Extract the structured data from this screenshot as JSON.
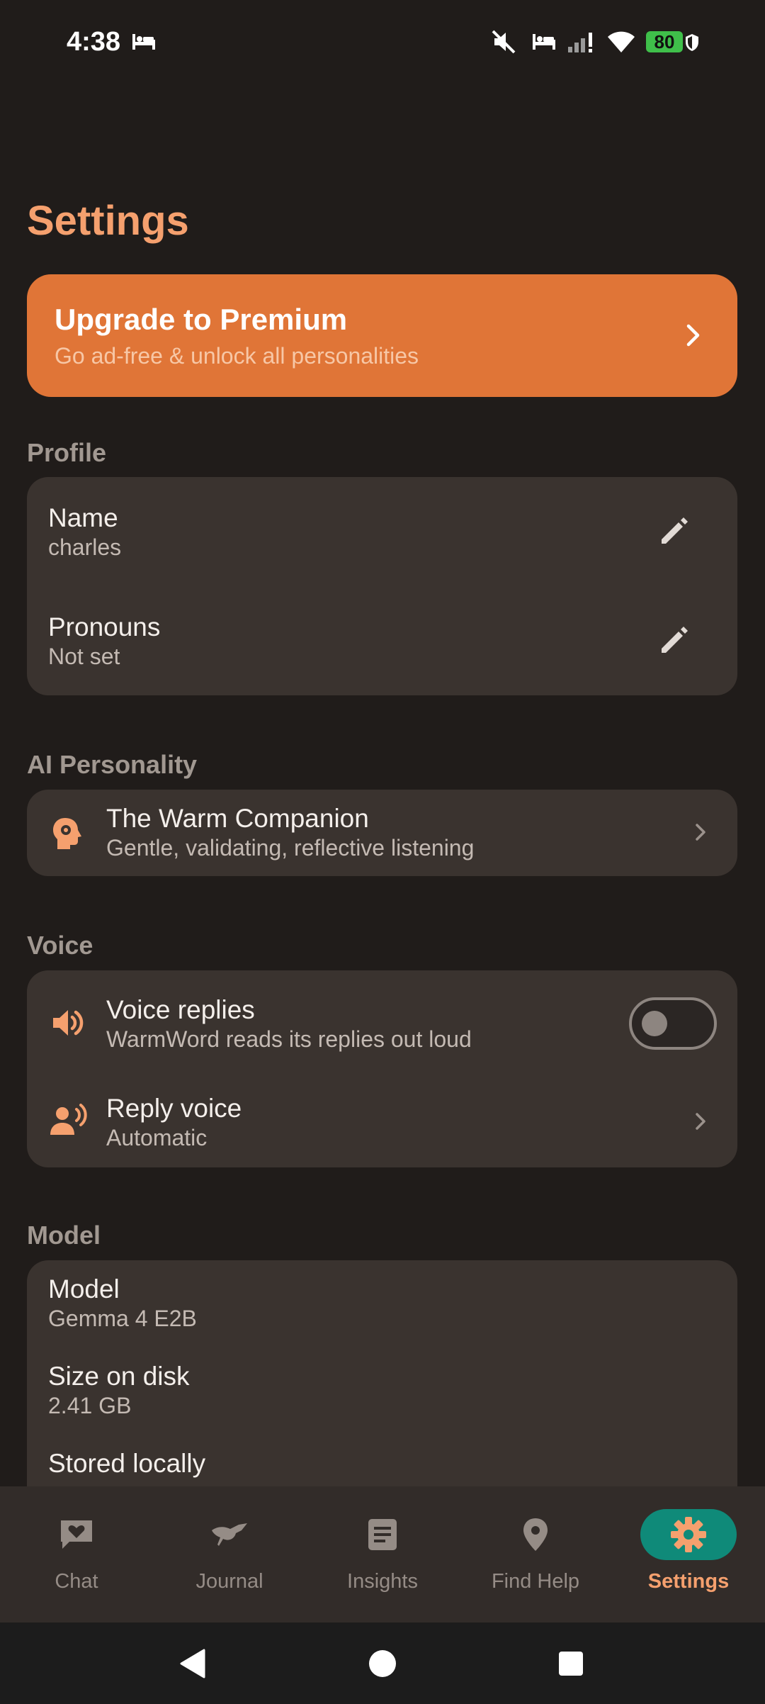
{
  "status_bar": {
    "time": "4:38",
    "battery": "80",
    "icons": [
      "sleep-mode-icon",
      "mute-icon",
      "sleep-mode-icon",
      "signal-icon",
      "wifi-icon",
      "battery-icon",
      "shield-icon"
    ]
  },
  "page": {
    "title": "Settings"
  },
  "premium": {
    "title": "Upgrade to Premium",
    "subtitle": "Go ad-free & unlock all personalities"
  },
  "profile": {
    "section_label": "Profile",
    "items": [
      {
        "title": "Name",
        "value": "charles"
      },
      {
        "title": "Pronouns",
        "value": "Not set"
      }
    ]
  },
  "personality": {
    "section_label": "AI Personality",
    "title": "The Warm Companion",
    "subtitle": "Gentle, validating, reflective listening"
  },
  "voice": {
    "section_label": "Voice",
    "voice_replies": {
      "title": "Voice replies",
      "subtitle": "WarmWord reads its replies out loud",
      "enabled": false
    },
    "reply_voice": {
      "title": "Reply voice",
      "value": "Automatic"
    }
  },
  "model": {
    "section_label": "Model",
    "items": [
      {
        "title": "Model",
        "value": "Gemma 4 E2B"
      },
      {
        "title": "Size on disk",
        "value": "2.41 GB"
      },
      {
        "title": "Stored locally",
        "value": ""
      }
    ]
  },
  "bottom_nav": {
    "active": "Settings",
    "items": [
      {
        "label": "Chat"
      },
      {
        "label": "Journal"
      },
      {
        "label": "Insights"
      },
      {
        "label": "Find Help"
      },
      {
        "label": "Settings"
      }
    ]
  },
  "colors": {
    "background": "#201c1a",
    "accent": "#f5a06e",
    "premium": "#e07537",
    "card": "#3a332f",
    "active_nav": "#0f8a79"
  }
}
